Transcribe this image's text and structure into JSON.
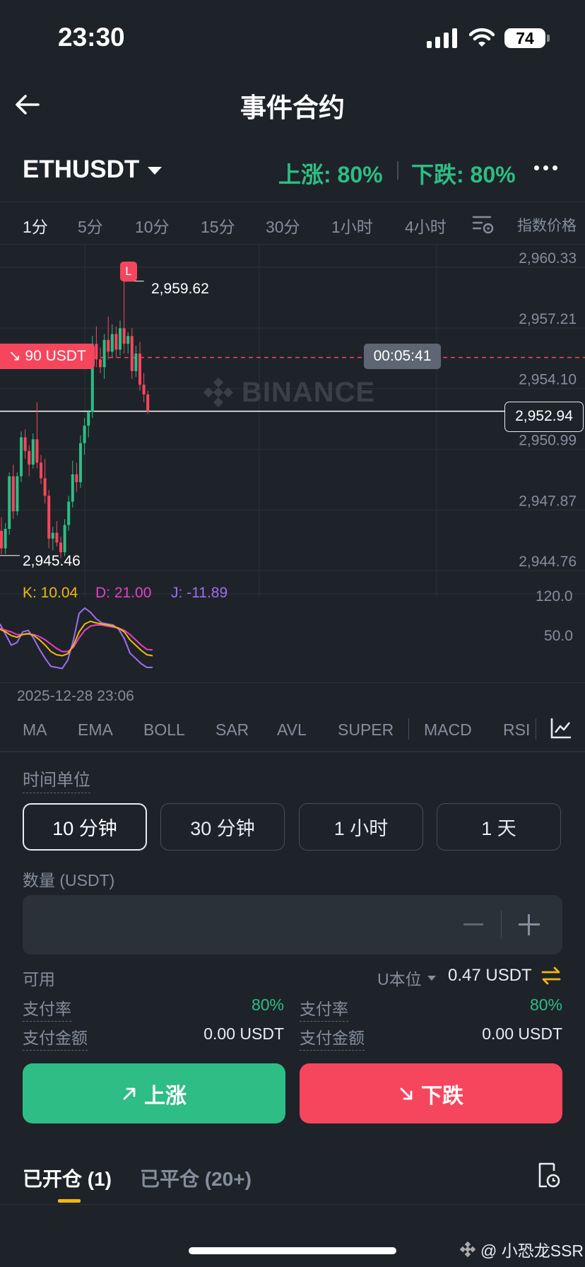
{
  "status_bar": {
    "time": "23:30",
    "battery": "74"
  },
  "nav": {
    "title": "事件合约"
  },
  "symbol": {
    "name": "ETHUSDT",
    "up_rate": "上涨: 80%",
    "down_rate": "下跌: 80%"
  },
  "intervals": [
    "1分",
    "5分",
    "10分",
    "15分",
    "30分",
    "1小时",
    "4小时"
  ],
  "active_interval": "1分",
  "index_price_label": "指数价格",
  "price_axis": [
    "2,960.33",
    "2,957.21",
    "2,954.10",
    "2,950.99",
    "2,947.87",
    "2,944.76"
  ],
  "current_price": "2,952.94",
  "high_marker": {
    "badge": "L",
    "value": "2,959.62"
  },
  "low_marker": {
    "value": "2,945.46"
  },
  "order_line": {
    "tag": "↘ 90 USDT",
    "countdown": "00:05:41"
  },
  "watermark": "BINANCE",
  "kdj": {
    "k": "K: 10.04",
    "d": "D: 21.00",
    "j": "J: -11.89",
    "axis": [
      "120.0",
      "50.0"
    ]
  },
  "time_label": "2025-12-28 23:06",
  "indicators": [
    "MA",
    "EMA",
    "BOLL",
    "SAR",
    "AVL",
    "SUPER",
    "MACD",
    "RSI"
  ],
  "time_unit": {
    "label": "时间单位",
    "options": [
      "10 分钟",
      "30 分钟",
      "1 小时",
      "1 天"
    ],
    "selected": "10 分钟"
  },
  "quantity": {
    "label": "数量 (USDT)",
    "value": ""
  },
  "available": {
    "label": "可用",
    "unit": "U本位",
    "value": "0.47 USDT"
  },
  "payout_up": {
    "rate_label": "支付率",
    "rate": "80%",
    "amount_label": "支付金额",
    "amount": "0.00 USDT"
  },
  "payout_down": {
    "rate_label": "支付率",
    "rate": "80%",
    "amount_label": "支付金额",
    "amount": "0.00 USDT"
  },
  "buttons": {
    "up": "上涨",
    "down": "下跌"
  },
  "tabs": {
    "open": "已开仓 (1)",
    "closed": "已平仓 (20+)"
  },
  "credit": "@ 小恐龙SSR",
  "colors": {
    "bg": "#1e2329",
    "up": "#2ebd85",
    "down": "#f6465d",
    "accent": "#f0b90b"
  },
  "chart_data": {
    "type": "candlestick",
    "interval": "1m",
    "ylim": [
      2944.76,
      2960.33
    ],
    "ticks": [
      2960.33,
      2957.21,
      2954.1,
      2950.99,
      2947.87,
      2944.76
    ],
    "last_price": 2952.94,
    "high": 2959.62,
    "low": 2945.46,
    "order_price": 2955.7,
    "candles": [
      [
        2946.8,
        2947.5,
        2945.6,
        2945.9
      ],
      [
        2945.9,
        2947.2,
        2945.6,
        2946.9
      ],
      [
        2946.9,
        2949.8,
        2946.6,
        2949.6
      ],
      [
        2949.6,
        2950.2,
        2947.4,
        2947.8
      ],
      [
        2947.8,
        2949.8,
        2947.6,
        2949.6
      ],
      [
        2949.6,
        2951.9,
        2949.3,
        2951.6
      ],
      [
        2951.6,
        2952.0,
        2950.5,
        2950.9
      ],
      [
        2950.9,
        2951.2,
        2949.6,
        2950.2
      ],
      [
        2950.2,
        2951.8,
        2950.0,
        2951.5
      ],
      [
        2951.5,
        2953.4,
        2950.0,
        2950.3
      ],
      [
        2950.3,
        2950.7,
        2949.2,
        2949.5
      ],
      [
        2949.5,
        2950.5,
        2948.2,
        2948.6
      ],
      [
        2948.6,
        2948.9,
        2945.9,
        2946.4
      ],
      [
        2946.4,
        2947.0,
        2945.8,
        2946.7
      ],
      [
        2946.7,
        2947.3,
        2946.0,
        2946.2
      ],
      [
        2946.2,
        2946.5,
        2945.4,
        2945.7
      ],
      [
        2945.7,
        2947.4,
        2945.5,
        2947.1
      ],
      [
        2947.1,
        2948.6,
        2946.8,
        2948.3
      ],
      [
        2948.3,
        2950.4,
        2948.0,
        2949.7
      ],
      [
        2949.7,
        2950.3,
        2948.8,
        2949.3
      ],
      [
        2949.3,
        2951.7,
        2949.0,
        2951.3
      ],
      [
        2951.3,
        2952.6,
        2950.7,
        2952.2
      ],
      [
        2952.2,
        2953.0,
        2951.6,
        2952.9
      ],
      [
        2952.9,
        2956.8,
        2952.6,
        2956.4
      ],
      [
        2956.4,
        2957.3,
        2955.2,
        2955.6
      ],
      [
        2955.6,
        2956.2,
        2954.9,
        2955.2
      ],
      [
        2955.2,
        2956.9,
        2954.6,
        2956.6
      ],
      [
        2956.6,
        2957.8,
        2955.6,
        2956.0
      ],
      [
        2956.0,
        2957.4,
        2955.7,
        2956.9
      ],
      [
        2956.9,
        2957.3,
        2955.7,
        2956.1
      ],
      [
        2956.1,
        2957.6,
        2955.8,
        2957.2
      ],
      [
        2957.2,
        2959.62,
        2955.9,
        2956.4
      ],
      [
        2956.4,
        2957.0,
        2955.9,
        2956.8
      ],
      [
        2956.8,
        2957.2,
        2954.6,
        2955.0
      ],
      [
        2955.0,
        2956.3,
        2954.7,
        2955.9
      ],
      [
        2955.9,
        2956.5,
        2954.0,
        2954.3
      ],
      [
        2954.3,
        2954.9,
        2953.4,
        2953.8
      ],
      [
        2953.8,
        2954.0,
        2952.8,
        2952.94
      ]
    ]
  }
}
